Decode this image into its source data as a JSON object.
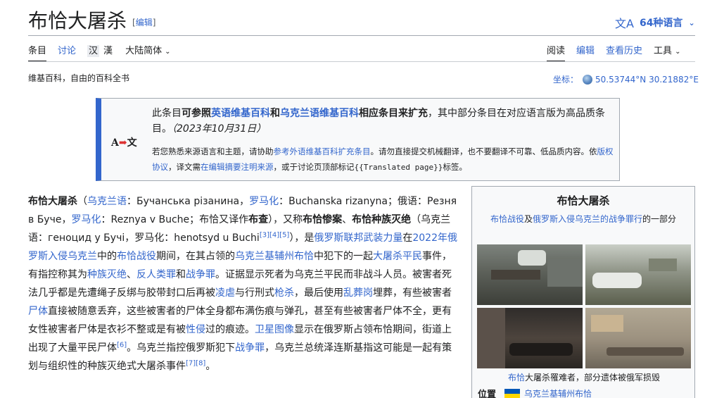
{
  "header": {
    "title": "布恰大屠杀",
    "edit_bracket_open": "[",
    "edit_label": "编辑",
    "edit_bracket_close": "]",
    "lang_icon": "文A",
    "lang_label": "64种语言",
    "lang_chevron": "⌄"
  },
  "tabs_left": {
    "article": "条目",
    "talk": "讨论",
    "variant_1": "汉",
    "variant_2": "漢",
    "variant_select": "大陆简体",
    "chevron": "⌄"
  },
  "tabs_right": {
    "read": "阅读",
    "edit": "编辑",
    "history": "查看历史",
    "tools": "工具",
    "chevron": "⌄"
  },
  "tagline": "维基百科，自由的百科全书",
  "coordinates": {
    "label": "坐标：",
    "value": "50.53744°N 30.21882°E"
  },
  "notice": {
    "icon_a": "A",
    "icon_arrow": "➡",
    "icon_b": "文",
    "t1": "此条目",
    "t2": "可参照",
    "link_en": "英语维基百科",
    "t3": "和",
    "link_uk": "乌克兰语维基百科",
    "t4": "相应条目来扩充",
    "t5": "，其中部分条目在对应语言版为高品质条目。",
    "date": "（2023年10月31日）",
    "s1": "若您熟悉来源语言和主题，请协助",
    "s_link1": "参考外语维基百科扩充条目",
    "s2": "。请勿直接提交机械翻译，也不要翻译不可靠、低品质内容。依",
    "s_link2": "版权协议",
    "s3": "，译文需",
    "s_link3": "在编辑摘要注明来源",
    "s4": "，或于讨论页顶部标记",
    "s_code": "{{Translated page}}",
    "s5": "标签。"
  },
  "article": {
    "p01": "布恰大屠杀",
    "p02": "（",
    "p03": "乌克兰语",
    "p04": "：Бучанська різанина，",
    "p05": "罗马化",
    "p06": "：Buchanska rizanyna；俄语：Резня в Буче，",
    "p07": "罗马化",
    "p08": "：Reznya v Buche；布恰又译作",
    "p09": "布查",
    "p10": "），又称",
    "p11": "布恰惨案",
    "p12": "、",
    "p13": "布恰种族灭绝",
    "p14": "（乌克兰语：геноцид у Бучі，罗马化：henotsyd u Buchi",
    "ref3": "[3]",
    "ref4": "[4]",
    "ref5": "[5]",
    "p15": "），是",
    "p16": "俄罗斯联邦武装力量",
    "p17": "在",
    "p18": "2022年俄罗斯入侵乌克兰",
    "p19": "中的",
    "p20": "布恰战役",
    "p21": "期间，在其占领的",
    "p22": "乌克兰基辅州布恰",
    "p23": "中犯下的一起",
    "p24": "大屠杀",
    "p25": "平民",
    "p26": "事件，有指控称其为",
    "p27": "种族灭绝",
    "p28": "、",
    "p29": "反人类罪",
    "p30": "和",
    "p31": "战争罪",
    "p32": "。证据显示死者为乌克兰平民而非战斗人员。被害者死法几乎都是先遭绳子反绑与胶带封口后再被",
    "p33": "凌虐",
    "p34": "与行刑式",
    "p35": "枪杀",
    "p36": "，最后使用",
    "p37": "乱葬岗",
    "p38": "埋葬，有些被害者",
    "p39": "尸体",
    "p40": "直接被随意丢弃，这些被害者的尸体全身都布满伤痕与弹孔，甚至有些被害者尸体不全，更有女性被害者尸体是衣衫不整或是有被",
    "p41": "性侵",
    "p42": "过的痕迹。",
    "p43": "卫星图像",
    "p44": "显示在俄罗斯占领布恰期间，街道上出现了大量平民尸体",
    "ref6": "[6]",
    "p45": "。乌克兰指控俄罗斯犯下",
    "p46": "战争罪",
    "p47": "，乌克兰总统泽连斯基指这可能是一起有策划与组织性的种族灭绝式大屠杀事件",
    "ref7": "[7]",
    "ref8": "[8]",
    "p48": "。"
  },
  "infobox": {
    "title": "布恰大屠杀",
    "sub_link1": "布恰战役",
    "sub_t1": "及",
    "sub_link2": "俄罗斯入侵乌克兰的战争罪行",
    "sub_t2": "的一部分",
    "caption_link": "布恰",
    "caption_text": "大屠杀罹难者，部分遗体被俄军损毁",
    "location_label": "位置",
    "location_value": "乌克兰基辅州布恰"
  }
}
